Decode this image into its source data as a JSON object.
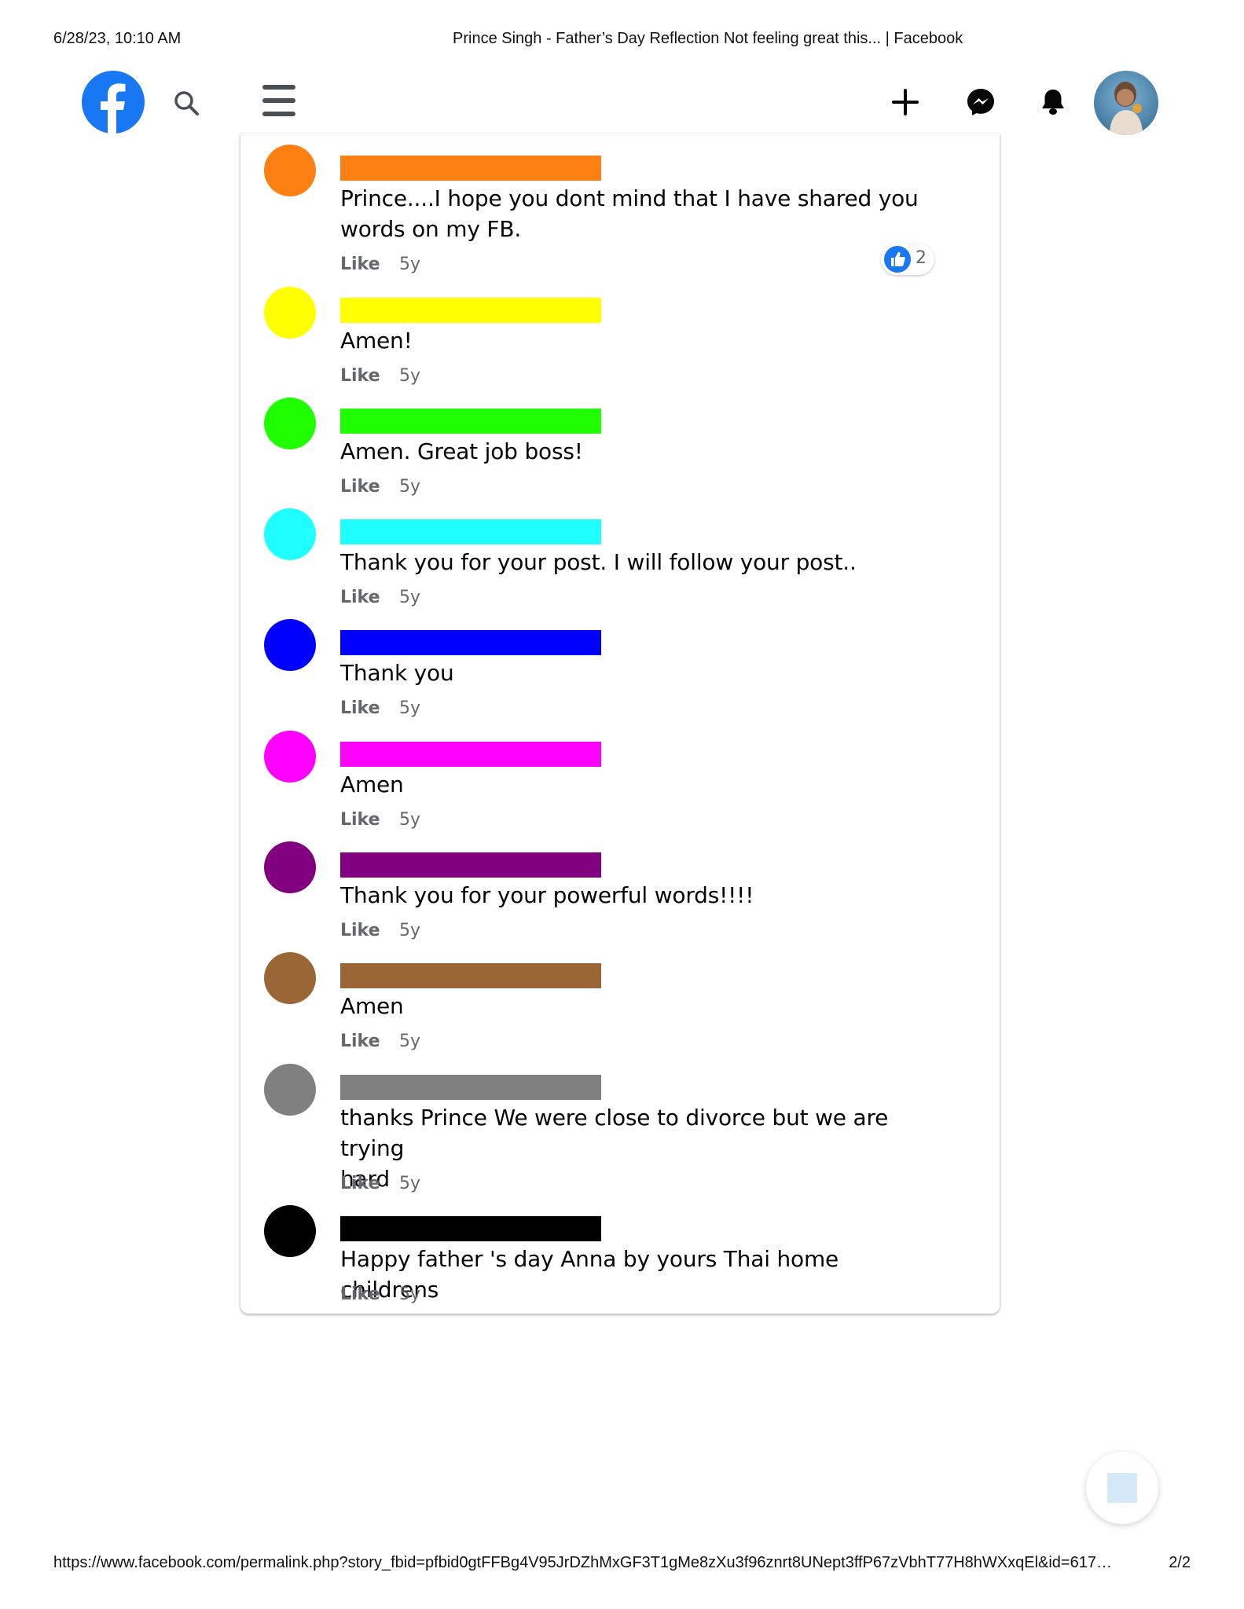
{
  "print": {
    "datetime": "6/28/23, 10:10 AM",
    "page_title": "Prince Singh - Father’s Day Reflection Not feeling great this... | Facebook",
    "url": "https://www.facebook.com/permalink.php?story_fbid=pfbid0gtFFBg4V95JrDZhMxGF3T1gMe8zXu3f96znrt8UNept3ffP67zVbhT77H8hWXxqEl&id=617…",
    "page_number": "2/2"
  },
  "nav": {
    "logo_icon": "facebook-logo-icon",
    "search_icon": "search-icon",
    "menu_icon": "hamburger-menu-icon",
    "create_icon": "plus-icon",
    "messenger_icon": "messenger-icon",
    "notifications_icon": "bell-icon",
    "brand_color": "#1877f2"
  },
  "comments": [
    {
      "redaction_color": "#fd8112",
      "text_lines": [
        "Prince....I hope you dont mind that I have shared you",
        "words on my FB."
      ],
      "like_label": "Like",
      "age": "5y",
      "reactions": {
        "icon": "thumbs-up-icon",
        "count": "2"
      }
    },
    {
      "redaction_color": "#ffff00",
      "text_lines": [
        "Amen!"
      ],
      "like_label": "Like",
      "age": "5y"
    },
    {
      "redaction_color": "#20ff00",
      "text_lines": [
        "Amen. Great job boss!"
      ],
      "like_label": "Like",
      "age": "5y"
    },
    {
      "redaction_color": "#20ffff",
      "text_lines": [
        "Thank you for your post. I will follow your post.."
      ],
      "like_label": "Like",
      "age": "5y"
    },
    {
      "redaction_color": "#0000ff",
      "text_lines": [
        "Thank you"
      ],
      "like_label": "Like",
      "age": "5y"
    },
    {
      "redaction_color": "#ff00ff",
      "text_lines": [
        "Amen"
      ],
      "like_label": "Like",
      "age": "5y"
    },
    {
      "redaction_color": "#800080",
      "text_lines": [
        "Thank you for your powerful words!!!!"
      ],
      "like_label": "Like",
      "age": "5y"
    },
    {
      "redaction_color": "#9b6636",
      "text_lines": [
        "Amen"
      ],
      "like_label": "Like",
      "age": "5y"
    },
    {
      "redaction_color": "#808080",
      "text_lines": [
        "thanks Prince We were close to divorce but we are trying",
        "hard"
      ],
      "like_label": "Like",
      "age": "5y"
    },
    {
      "redaction_color": "#000000",
      "text_lines": [
        "Happy father 's day Anna by yours Thai home childrens"
      ],
      "like_label": "Like",
      "age": "5y"
    }
  ]
}
